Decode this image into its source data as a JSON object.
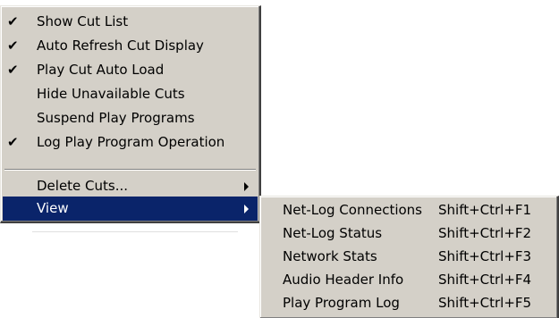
{
  "main_menu": {
    "items": [
      {
        "label": "Show Cut List",
        "checked": "✔"
      },
      {
        "label": "Auto Refresh Cut Display",
        "checked": "✔"
      },
      {
        "label": "Play Cut Auto Load",
        "checked": "✔"
      },
      {
        "label": "Hide Unavailable Cuts",
        "checked": ""
      },
      {
        "label": "Suspend Play Programs",
        "checked": ""
      },
      {
        "label": "Log Play Program Operation",
        "checked": "✔"
      }
    ],
    "delete_cuts": "Delete Cuts...",
    "view": "View"
  },
  "sub_menu": {
    "items": [
      {
        "label": "Net-Log Connections",
        "shortcut": "Shift+Ctrl+F1"
      },
      {
        "label": "Net-Log Status",
        "shortcut": "Shift+Ctrl+F2"
      },
      {
        "label": "Network Stats",
        "shortcut": "Shift+Ctrl+F3"
      },
      {
        "label": "Audio Header Info",
        "shortcut": "Shift+Ctrl+F4"
      },
      {
        "label": "Play Program Log",
        "shortcut": "Shift+Ctrl+F5"
      }
    ]
  },
  "colors": {
    "menu_background": "#d4d0c8",
    "highlight": "#0a246a",
    "highlight_text": "#ffffff"
  },
  "icons": {
    "check": "checkmark-icon",
    "submenu_arrow": "submenu-arrow-icon"
  }
}
